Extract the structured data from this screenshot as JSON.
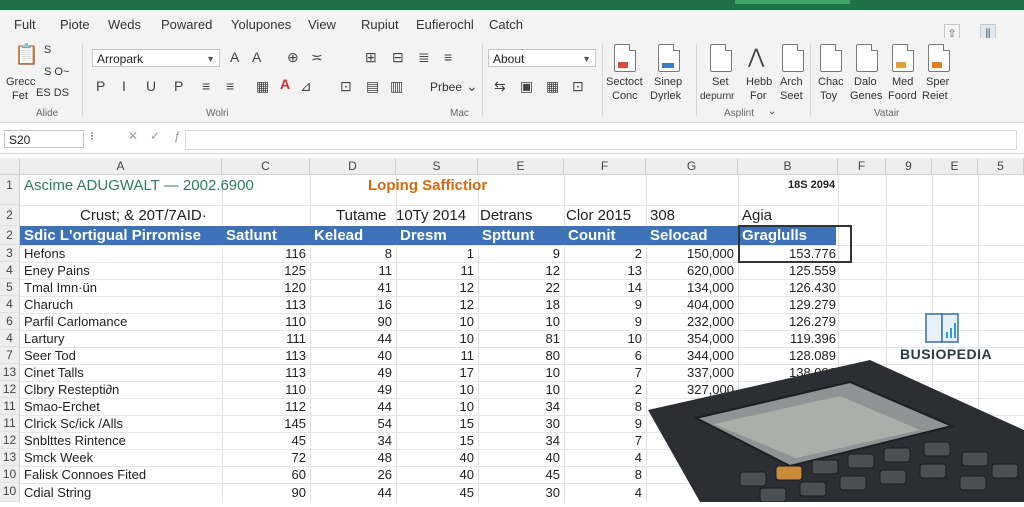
{
  "title_bar": {
    "color": "#1e7145"
  },
  "menu_tabs": [
    "Fult",
    "Piote",
    "Weds",
    "Powared",
    "Yolupones",
    "View",
    "Rupiut",
    "Eufierochl",
    "Catch"
  ],
  "ribbon": {
    "clipboard": {
      "line1": "Grecc",
      "line2": "Fet",
      "small1": "S",
      "small2": "S O~",
      "small3": "ES DS",
      "group_label": "Alide"
    },
    "font": {
      "name": "Arropark",
      "group_label": "Wolri",
      "small_text": "Prbee"
    },
    "number": {
      "format": "About",
      "group_label": "Mac"
    },
    "styles": {
      "items": [
        {
          "l1": "Sectoct",
          "l2": "Conc"
        },
        {
          "l1": "Sinep",
          "l2": "Dyrlek"
        }
      ]
    },
    "cells": {
      "items": [
        {
          "l1": "Set",
          "l2": "depurnr"
        },
        {
          "l1": "Hebb",
          "l2": "For"
        },
        {
          "l1": "Arch",
          "l2": "Seet"
        }
      ],
      "group_label": "Asplint"
    },
    "editing": {
      "items": [
        {
          "l1": "Chac",
          "l2": "Toy"
        },
        {
          "l1": "Dalo",
          "l2": "Genes"
        },
        {
          "l1": "Med",
          "l2": "Foord"
        },
        {
          "l1": "Sper",
          "l2": "Reiet"
        }
      ],
      "group_label": "Vatair"
    }
  },
  "name_box": "S20",
  "columns": [
    "A",
    "C",
    "D",
    "S",
    "E",
    "F",
    "G",
    "B",
    "F",
    "9",
    "E",
    "5"
  ],
  "rows": [
    {
      "n": "1",
      "a": "Ascime ADUGWALT — 2002.6900",
      "d": "Loping Saffictior",
      "h": "18S 2094"
    },
    {
      "n": "2",
      "a": "Crust; & 20T/7AID·",
      "c": "Tutame",
      "d": "10Ty 2014",
      "s": "Detrans",
      "f": "Clor 2015",
      "g": "308",
      "h": "Agia"
    },
    {
      "n": "2"
    },
    {
      "n": "3",
      "a": "Hefons",
      "c": "116",
      "d": "8",
      "s": "1",
      "e": "9",
      "f": "2",
      "g": "150,000",
      "h": "153.776"
    },
    {
      "n": "4",
      "a": "Eney Pains",
      "c": "125",
      "d": "11",
      "s": "11",
      "e": "12",
      "f": "13",
      "g": "620,000",
      "h": "125.559"
    },
    {
      "n": "5",
      "a": "Tmal Imn·ün",
      "c": "120",
      "d": "41",
      "s": "12",
      "e": "22",
      "f": "14",
      "g": "134,000",
      "h": "126.430"
    },
    {
      "n": "4",
      "a": "Charuch",
      "c": "113",
      "d": "16",
      "s": "12",
      "e": "18",
      "f": "9",
      "g": "404,000",
      "h": "129.279"
    },
    {
      "n": "6",
      "a": "Parfil Carlomance",
      "c": "110",
      "d": "90",
      "s": "10",
      "e": "10",
      "f": "9",
      "g": "232,000",
      "h": "126.279"
    },
    {
      "n": "4",
      "a": "Lartury",
      "c": "111",
      "d": "44",
      "s": "10",
      "e": "81",
      "f": "10",
      "g": "354,000",
      "h": "119.396"
    },
    {
      "n": "7",
      "a": "Seer Tod",
      "c": "113",
      "d": "40",
      "s": "11",
      "e": "80",
      "f": "6",
      "g": "344,000",
      "h": "128.089"
    },
    {
      "n": "13",
      "a": "Cinet Talls",
      "c": "113",
      "d": "49",
      "s": "17",
      "e": "10",
      "f": "7",
      "g": "337,000",
      "h": "138.006"
    },
    {
      "n": "12",
      "a": "Clbry Restepti∂n",
      "c": "110",
      "d": "49",
      "s": "10",
      "e": "10",
      "f": "2",
      "g": "327,000"
    },
    {
      "n": "11",
      "a": "Smao-Erchet",
      "c": "112",
      "d": "44",
      "s": "10",
      "e": "34",
      "f": "8"
    },
    {
      "n": "11",
      "a": "Clrick Sc/ick /Alls",
      "c": "145",
      "d": "54",
      "s": "15",
      "e": "30",
      "f": "9"
    },
    {
      "n": "12",
      "a": "Snblttes Rintence",
      "c": "45",
      "d": "34",
      "s": "15",
      "e": "34",
      "f": "7"
    },
    {
      "n": "13",
      "a": "Smck Week",
      "c": "72",
      "d": "48",
      "s": "40",
      "e": "40",
      "f": "4"
    },
    {
      "n": "10",
      "a": "Falisk Connoes Fited",
      "c": "60",
      "d": "26",
      "s": "40",
      "e": "45",
      "f": "8"
    },
    {
      "n": "10",
      "a": "Cdial String",
      "c": "90",
      "d": "44",
      "s": "45",
      "e": "30",
      "f": "4",
      "g": "450,"
    }
  ],
  "header_row": {
    "a": "Sdic L'ortigual Pirromise",
    "c": "Satlunt",
    "d": "Kelead",
    "s": "Dresm",
    "e": "Spttunt",
    "f": "Counit",
    "g": "Selocad",
    "h": "Graglulls"
  },
  "colors": {
    "header_band": "#3d72b8",
    "title_green": "#2e7d5b",
    "title_orange": "#d46a10",
    "grid": "#e2e2e2"
  },
  "logo": {
    "text": "BUSIOPEDIA"
  }
}
